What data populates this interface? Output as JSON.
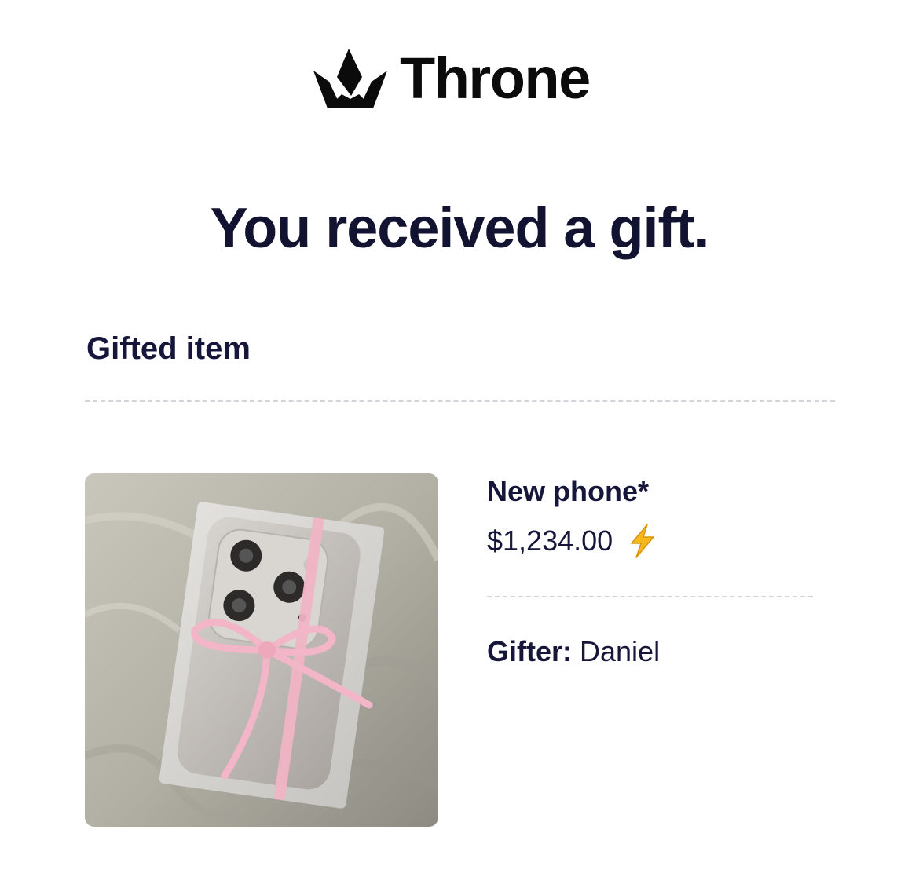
{
  "brand": {
    "name": "Throne",
    "logo_icon": "crown-icon"
  },
  "headline": "You received a gift.",
  "section": {
    "title": "Gifted item"
  },
  "item": {
    "image_icon": "gift-phone-photo",
    "name": "New phone*",
    "price": "$1,234.00",
    "price_icon": "lightning-bolt-icon",
    "gifter_label": "Gifter:",
    "gifter_name": "Daniel"
  },
  "colors": {
    "text": "#16163a",
    "headline": "#121231",
    "divider": "#d3d3d9",
    "bolt": "#f5b81c",
    "ribbon": "#f2b6c8"
  }
}
